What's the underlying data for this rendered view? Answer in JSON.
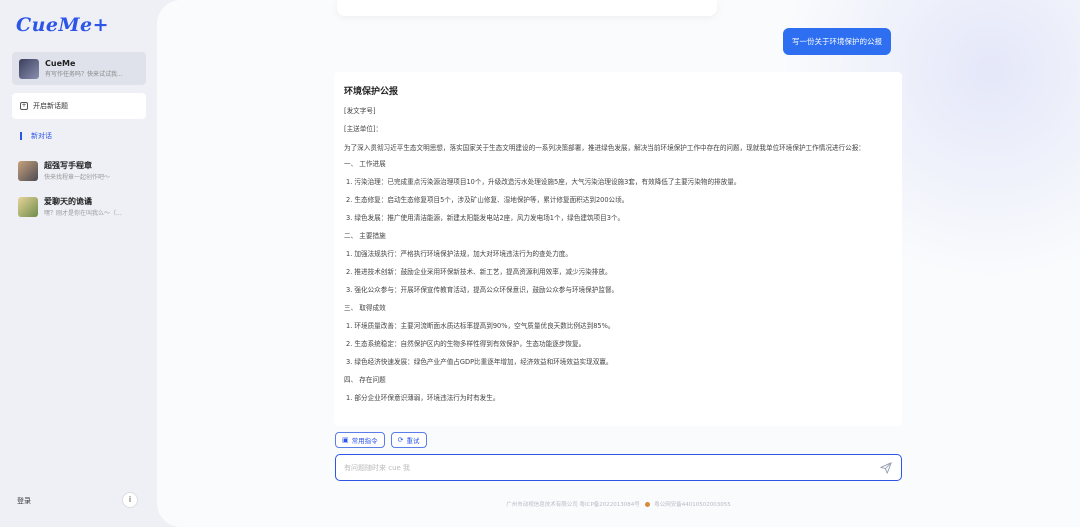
{
  "app": {
    "logo": "CueMe+"
  },
  "sidebar": {
    "agent": {
      "name": "CueMe",
      "subtitle": "有写作任务吗？快来试试我..."
    },
    "new_topic": "开启新话题",
    "current_topic": "新对话",
    "conversations": [
      {
        "name": "超强写手程章",
        "subtitle": "快来找程章一起创作吧～"
      },
      {
        "name": "爱聊天的诡谲",
        "subtitle": "嘿？刚才是你在叫我么～（..."
      }
    ],
    "login": "登录",
    "info_icon": "info-icon"
  },
  "chat": {
    "user_message": "写一份关于环境保护的公报",
    "doc": {
      "title": "环境保护公报",
      "doc_number": "[发文字号]",
      "recipient": "[主送单位]：",
      "intro": "为了深入贯彻习近平生态文明思想，落实国家关于生态文明建设的一系列决策部署，推进绿色发展，解决当前环境保护工作中存在的问题，现就我单位环境保护工作情况进行公报：",
      "sections": [
        {
          "heading": "一、 工作进展",
          "items": [
            "1. 污染治理：已完成重点污染源治理项目10个，升级改造污水处理设施5座，大气污染治理设施3套，有效降低了主要污染物的排放量。",
            "2. 生态修复：启动生态修复项目5个，涉及矿山修复、湿地保护等，累计修复面积达到200公顷。",
            "3. 绿色发展：推广使用清洁能源，新建太阳能发电站2座，风力发电场1个，绿色建筑项目3个。"
          ]
        },
        {
          "heading": "二、 主要措施",
          "items": [
            "1. 加强法规执行：严格执行环境保护法规，加大对环境违法行为的查处力度。",
            "2. 推进技术创新：鼓励企业采用环保新技术、新工艺，提高资源利用效率，减少污染排放。",
            "3. 强化公众参与：开展环保宣传教育活动，提高公众环保意识，鼓励公众参与环境保护监督。"
          ]
        },
        {
          "heading": "三、 取得成效",
          "items": [
            "1. 环境质量改善：主要河流断面水质达标率提高到90%，空气质量优良天数比例达到85%。",
            "2. 生态系统稳定：自然保护区内的生物多样性得到有效保护，生态功能逐步恢复。",
            "3. 绿色经济快速发展：绿色产业产值占GDP比重逐年增加，经济效益和环境效益实现双赢。"
          ]
        },
        {
          "heading": "四、 存在问题",
          "items": [
            "1. 部分企业环保意识薄弱，环境违法行为时有发生。"
          ]
        }
      ]
    },
    "actions": {
      "common_commands": "常用指令",
      "retry": "重试"
    },
    "input": {
      "placeholder": "有问题随时来 cue 我",
      "value": ""
    },
    "footer": {
      "company": "广州市动视信息技术有限公司 粤ICP备2022013084号",
      "police": "粤公网安备44010502003055"
    }
  }
}
